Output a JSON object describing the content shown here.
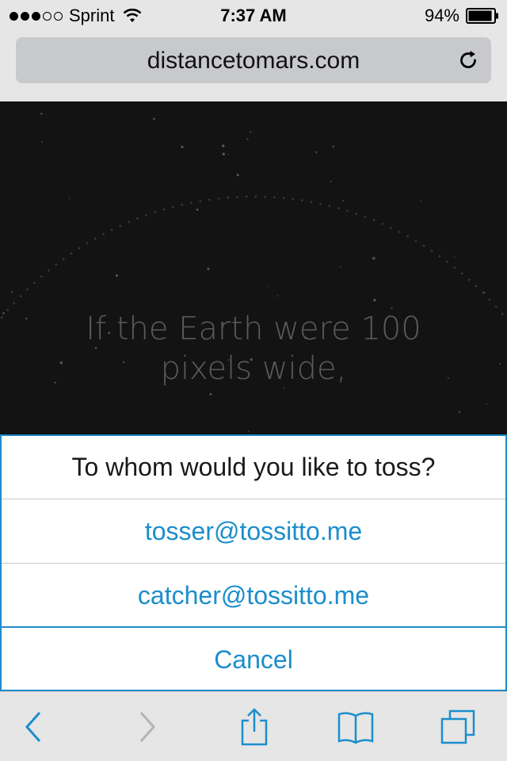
{
  "status_bar": {
    "carrier": "Sprint",
    "signal_bars_filled": 3,
    "signal_bars_total": 5,
    "time": "7:37 AM",
    "battery_percent": "94%",
    "battery_level": 0.94
  },
  "browser": {
    "url": "distancetomars.com",
    "reload_icon": "reload-icon"
  },
  "web_content": {
    "hero_line1": "If the Earth were 100",
    "hero_line2": "pixels wide,"
  },
  "action_sheet": {
    "title": "To whom would you like to toss?",
    "options": [
      {
        "label": "tosser@tossitto.me"
      },
      {
        "label": "catcher@tossitto.me"
      }
    ],
    "cancel_label": "Cancel",
    "accent_color": "#1b8ecb"
  },
  "toolbar": {
    "icons": [
      "back-icon",
      "forward-icon",
      "share-icon",
      "bookmarks-icon",
      "tabs-icon"
    ],
    "accent_color": "#1b8ecb",
    "disabled_color": "#b4b4b4"
  }
}
